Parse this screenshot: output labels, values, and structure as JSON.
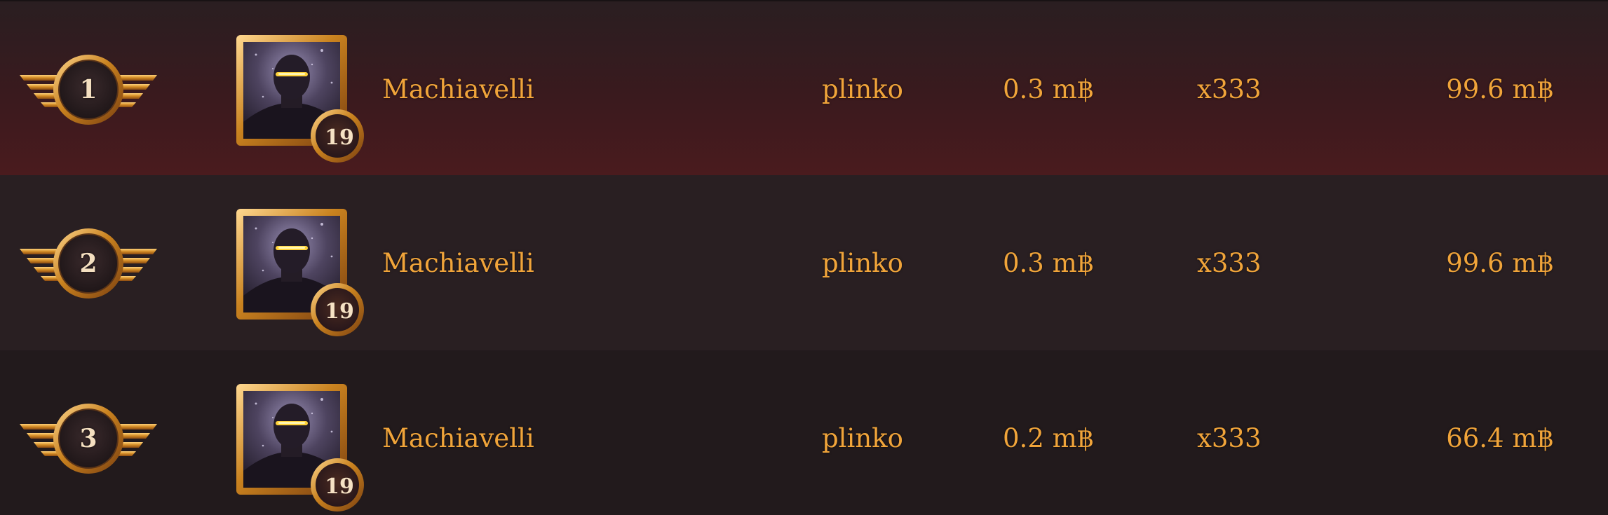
{
  "leaderboard": {
    "currency_symbol": "m฿",
    "colors": {
      "gold_text": "#f0a43a",
      "medal_gold": "#c8862a",
      "highlight_row": "#4a1b1e"
    },
    "rows": [
      {
        "rank": "1",
        "level": "19",
        "player": "Machiavelli",
        "game": "plinko",
        "bet": "0.3 m฿",
        "multiplier": "x333",
        "payout": "99.6 m฿",
        "avatar_icon": "masked-figure-portrait"
      },
      {
        "rank": "2",
        "level": "19",
        "player": "Machiavelli",
        "game": "plinko",
        "bet": "0.3 m฿",
        "multiplier": "x333",
        "payout": "99.6 m฿",
        "avatar_icon": "masked-figure-portrait"
      },
      {
        "rank": "3",
        "level": "19",
        "player": "Machiavelli",
        "game": "plinko",
        "bet": "0.2 m฿",
        "multiplier": "x333",
        "payout": "66.4 m฿",
        "avatar_icon": "masked-figure-portrait"
      }
    ]
  }
}
